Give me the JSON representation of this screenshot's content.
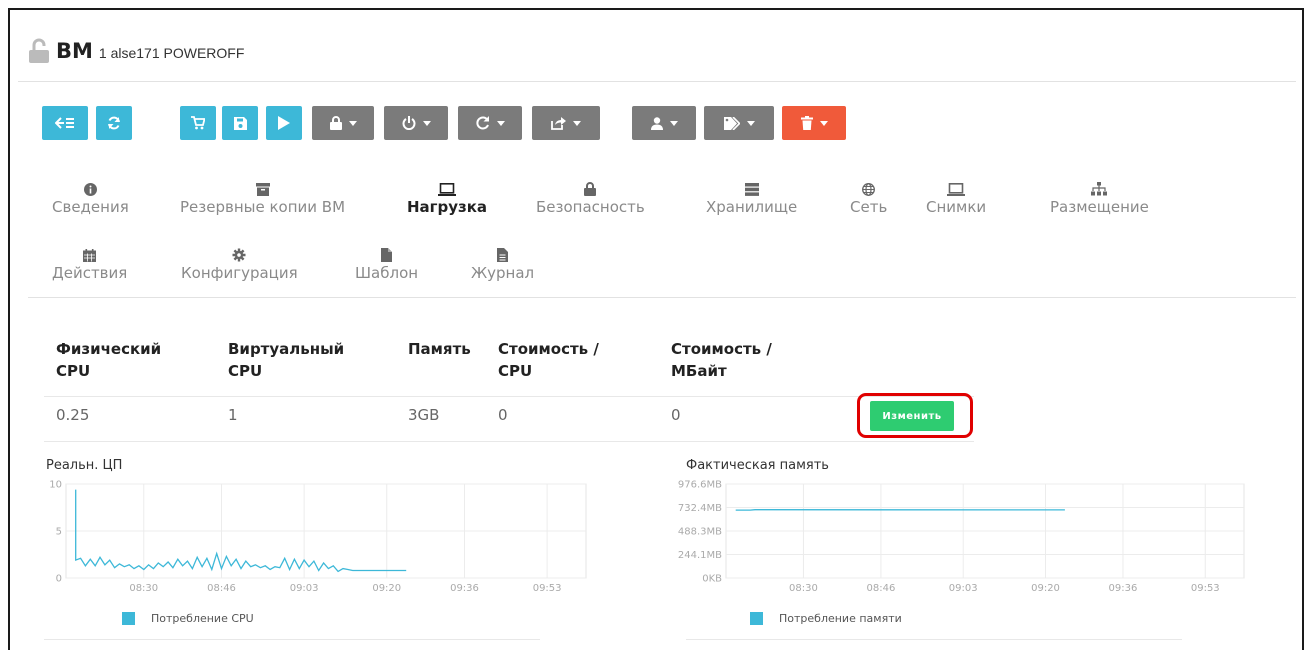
{
  "header": {
    "title": "ВМ",
    "subtitle": "1 alse171 POWEROFF"
  },
  "toolbar": {
    "colors": {
      "primary": "#3db8d8",
      "secondary": "#7b7b7b",
      "danger": "#f05a3a"
    },
    "buttons": [
      {
        "icon": "back-list-icon",
        "style": "primary",
        "dropdown": false
      },
      {
        "icon": "refresh-icon",
        "style": "primary",
        "dropdown": false
      },
      {
        "icon": "cart-icon",
        "style": "primary",
        "dropdown": false
      },
      {
        "icon": "save-icon",
        "style": "primary",
        "dropdown": false
      },
      {
        "icon": "play-icon",
        "style": "primary",
        "dropdown": false
      },
      {
        "icon": "lock-icon",
        "style": "secondary",
        "dropdown": true
      },
      {
        "icon": "power-icon",
        "style": "secondary",
        "dropdown": true
      },
      {
        "icon": "reload-icon",
        "style": "secondary",
        "dropdown": true
      },
      {
        "icon": "share-icon",
        "style": "secondary",
        "dropdown": true
      },
      {
        "icon": "user-icon",
        "style": "secondary",
        "dropdown": true
      },
      {
        "icon": "tag-icon",
        "style": "secondary",
        "dropdown": true
      },
      {
        "icon": "trash-icon",
        "style": "danger",
        "dropdown": true
      }
    ]
  },
  "tabs": [
    {
      "label": "Сведения",
      "icon": "info-icon"
    },
    {
      "label": "Резервные копии ВМ",
      "icon": "archive-icon"
    },
    {
      "label": "Нагрузка",
      "icon": "laptop-icon",
      "active": true
    },
    {
      "label": "Безопасность",
      "icon": "lock-icon"
    },
    {
      "label": "Хранилище",
      "icon": "storage-icon"
    },
    {
      "label": "Сеть",
      "icon": "globe-icon"
    },
    {
      "label": "Снимки",
      "icon": "laptop-icon"
    },
    {
      "label": "Размещение",
      "icon": "sitemap-icon"
    },
    {
      "label": "Действия",
      "icon": "calendar-icon"
    },
    {
      "label": "Конфигурация",
      "icon": "gear-icon"
    },
    {
      "label": "Шаблон",
      "icon": "file-icon"
    },
    {
      "label": "Журнал",
      "icon": "file-text-icon"
    }
  ],
  "capacity_table": {
    "headers": [
      [
        "Физический",
        "CPU"
      ],
      [
        "Виртуальный",
        "CPU"
      ],
      [
        "Память"
      ],
      [
        "Стоимость /",
        "CPU"
      ],
      [
        "Стоимость /",
        "МБайт"
      ]
    ],
    "row": [
      "0.25",
      "1",
      "3GB",
      "0",
      "0"
    ],
    "edit_button": "Изменить"
  },
  "chart_data": [
    {
      "type": "line",
      "title": "Реальн. ЦП",
      "x_ticks": [
        "08:30",
        "08:46",
        "09:03",
        "09:20",
        "09:36",
        "09:53"
      ],
      "y_ticks": [
        "0",
        "5",
        "10"
      ],
      "ylim": [
        0,
        10
      ],
      "series": [
        {
          "name": "Потребление CPU",
          "color": "#3db8d8",
          "x": [
            "08:16",
            "08:16",
            "08:17",
            "08:18",
            "08:19",
            "08:20",
            "08:21",
            "08:22",
            "08:23",
            "08:24",
            "08:25",
            "08:26",
            "08:27",
            "08:28",
            "08:29",
            "08:30",
            "08:31",
            "08:32",
            "08:33",
            "08:34",
            "08:35",
            "08:36",
            "08:37",
            "08:38",
            "08:39",
            "08:40",
            "08:41",
            "08:42",
            "08:43",
            "08:44",
            "08:45",
            "08:46",
            "08:47",
            "08:48",
            "08:49",
            "08:50",
            "08:51",
            "08:52",
            "08:53",
            "08:54",
            "08:55",
            "08:56",
            "08:57",
            "08:58",
            "08:59",
            "09:00",
            "09:01",
            "09:02",
            "09:03",
            "09:04",
            "09:05",
            "09:06",
            "09:07",
            "09:08",
            "09:09",
            "09:10",
            "09:11",
            "09:12",
            "09:13",
            "09:14",
            "09:15",
            "09:16",
            "09:17",
            "09:18",
            "09:19",
            "09:20",
            "09:21",
            "09:22",
            "09:23",
            "09:24"
          ],
          "values": [
            9.4,
            1.9,
            2.1,
            1.3,
            2.0,
            1.3,
            2.2,
            1.4,
            1.9,
            1.1,
            1.5,
            1.2,
            1.4,
            1.0,
            1.3,
            0.9,
            1.4,
            1.0,
            1.6,
            1.2,
            1.7,
            1.1,
            2.0,
            1.3,
            1.8,
            1.0,
            2.2,
            1.2,
            2.1,
            0.9,
            2.6,
            1.0,
            2.3,
            1.3,
            2.0,
            1.0,
            1.8,
            1.2,
            1.4,
            1.1,
            1.3,
            0.9,
            1.2,
            1.1,
            2.1,
            0.9,
            2.0,
            1.0,
            1.9,
            1.2,
            1.8,
            0.8,
            1.6,
            1.0,
            1.3,
            0.7,
            1.0,
            0.9,
            0.8,
            0.8,
            0.8,
            0.8,
            0.8,
            0.8,
            0.8,
            0.8,
            0.8,
            0.8,
            0.8,
            0.8
          ]
        }
      ]
    },
    {
      "type": "line",
      "title": "Фактическая память",
      "x_ticks": [
        "08:30",
        "08:46",
        "09:03",
        "09:20",
        "09:36",
        "09:53"
      ],
      "y_ticks": [
        "0KB",
        "244.1MB",
        "488.3MB",
        "732.4MB",
        "976.6MB"
      ],
      "ylim": [
        0,
        976.6
      ],
      "series": [
        {
          "name": "Потребление памяти",
          "color": "#3db8d8",
          "x": [
            "08:16",
            "08:19",
            "08:20",
            "09:14",
            "09:24"
          ],
          "values": [
            705,
            705,
            710,
            708,
            708
          ]
        }
      ]
    }
  ]
}
